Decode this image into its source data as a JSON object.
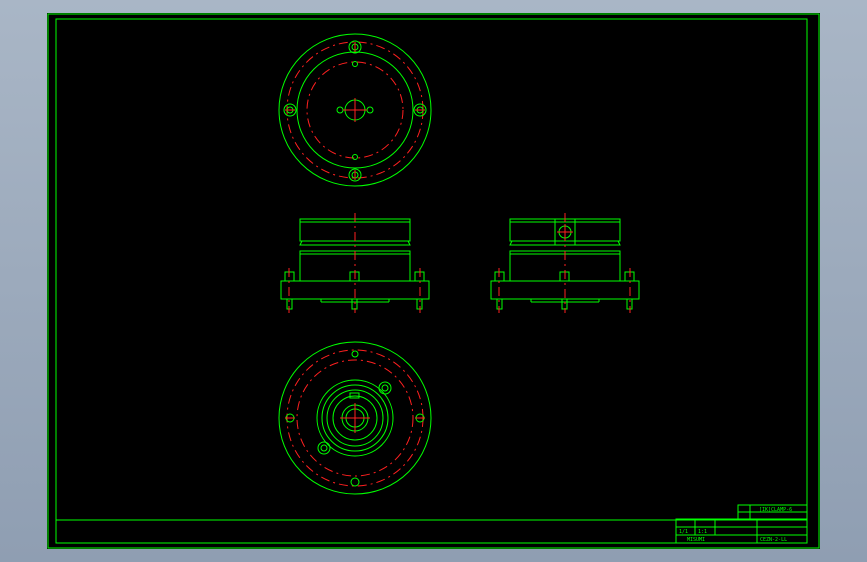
{
  "title_block": {
    "model_text": "[IK]CLAMP-6",
    "sheet_text": "1/1",
    "scale_text": "1:1",
    "company_text": "MISUMI",
    "code_text": "CEZN-2-LL"
  },
  "colors": {
    "background": "#000000",
    "outline": "#00ff00",
    "centerline": "#ff2020",
    "viewport_bg": "#9aa8bb"
  }
}
